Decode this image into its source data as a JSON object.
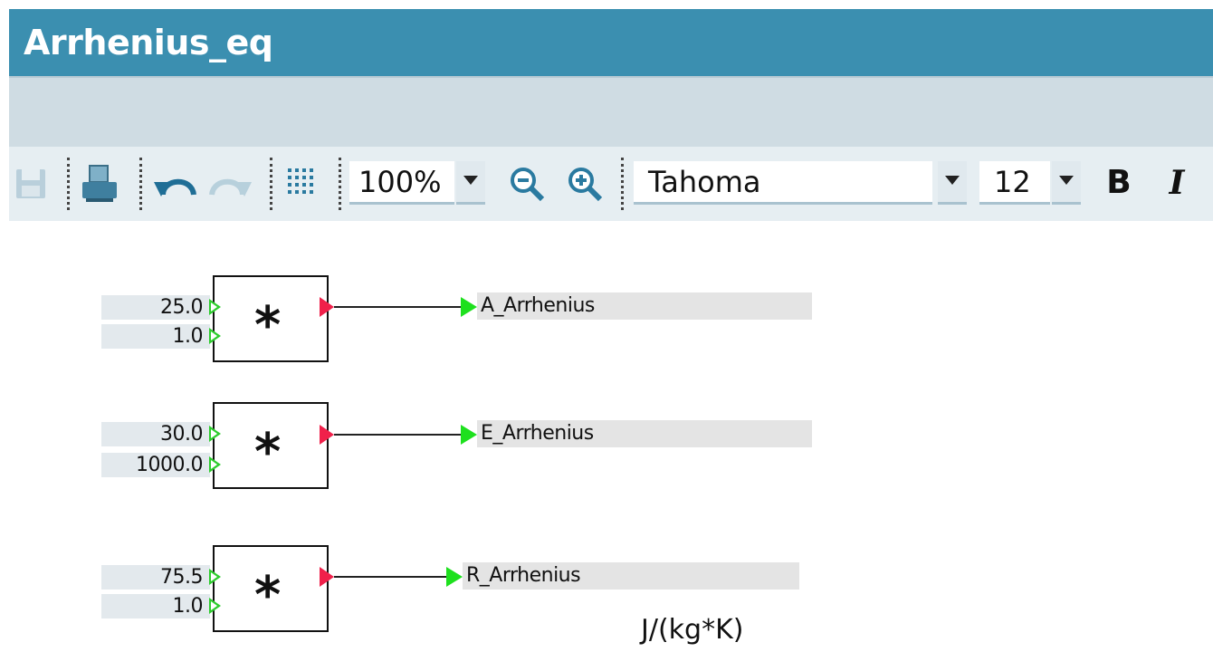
{
  "window": {
    "title": "Arrhenius_eq"
  },
  "toolbar": {
    "zoom": {
      "value": "100%"
    },
    "font": {
      "family": "Tahoma",
      "size": "12"
    },
    "bold_label": "B",
    "italic_label": "I"
  },
  "blocks": [
    {
      "operator": "*",
      "inputs": [
        "25.0",
        "1.0"
      ],
      "output": "A_Arrhenius"
    },
    {
      "operator": "*",
      "inputs": [
        "30.0",
        "1000.0"
      ],
      "output": "E_Arrhenius"
    },
    {
      "operator": "*",
      "inputs": [
        "75.5",
        "1.0"
      ],
      "output": "R_Arrhenius"
    }
  ],
  "unit_label": "J/(kg*K)",
  "colors": {
    "titlebar": "#3b8fb0",
    "input_pin": "#2ccc2c",
    "output_pin": "#f0204a",
    "signal_arrow": "#1ee01e"
  }
}
